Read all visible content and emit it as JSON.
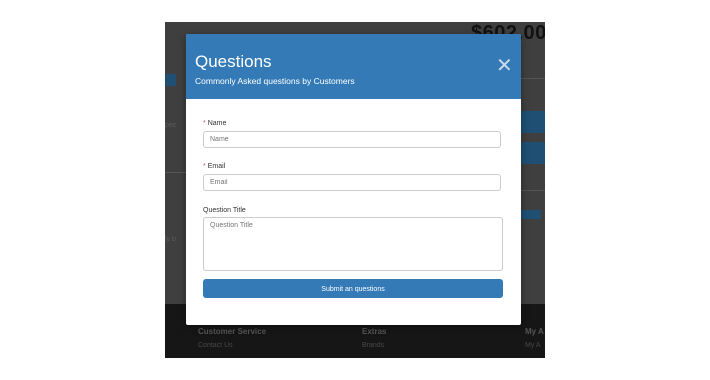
{
  "background": {
    "price": "$602.00",
    "footer": {
      "col1_heading": "Customer Service",
      "col1_link": "Contact Us",
      "col2_heading": "Extras",
      "col2_link": "Brands",
      "col3_heading": "My A",
      "col3_link": "My A"
    },
    "side_text_left": "ly b",
    "side_text_left2": "pec"
  },
  "modal": {
    "title": "Questions",
    "subtitle": "Commonly Asked questions by Customers",
    "close_label": "✕"
  },
  "form": {
    "name": {
      "label": "Name",
      "placeholder": "Name",
      "required": true
    },
    "email": {
      "label": "Email",
      "placeholder": "Email",
      "required": true
    },
    "question_title": {
      "label": "Question Title",
      "placeholder": "Question Title"
    },
    "submit_label": "Submit an questions",
    "required_marker": "*"
  },
  "colors": {
    "accent": "#337ab7",
    "required": "#d9534f"
  }
}
